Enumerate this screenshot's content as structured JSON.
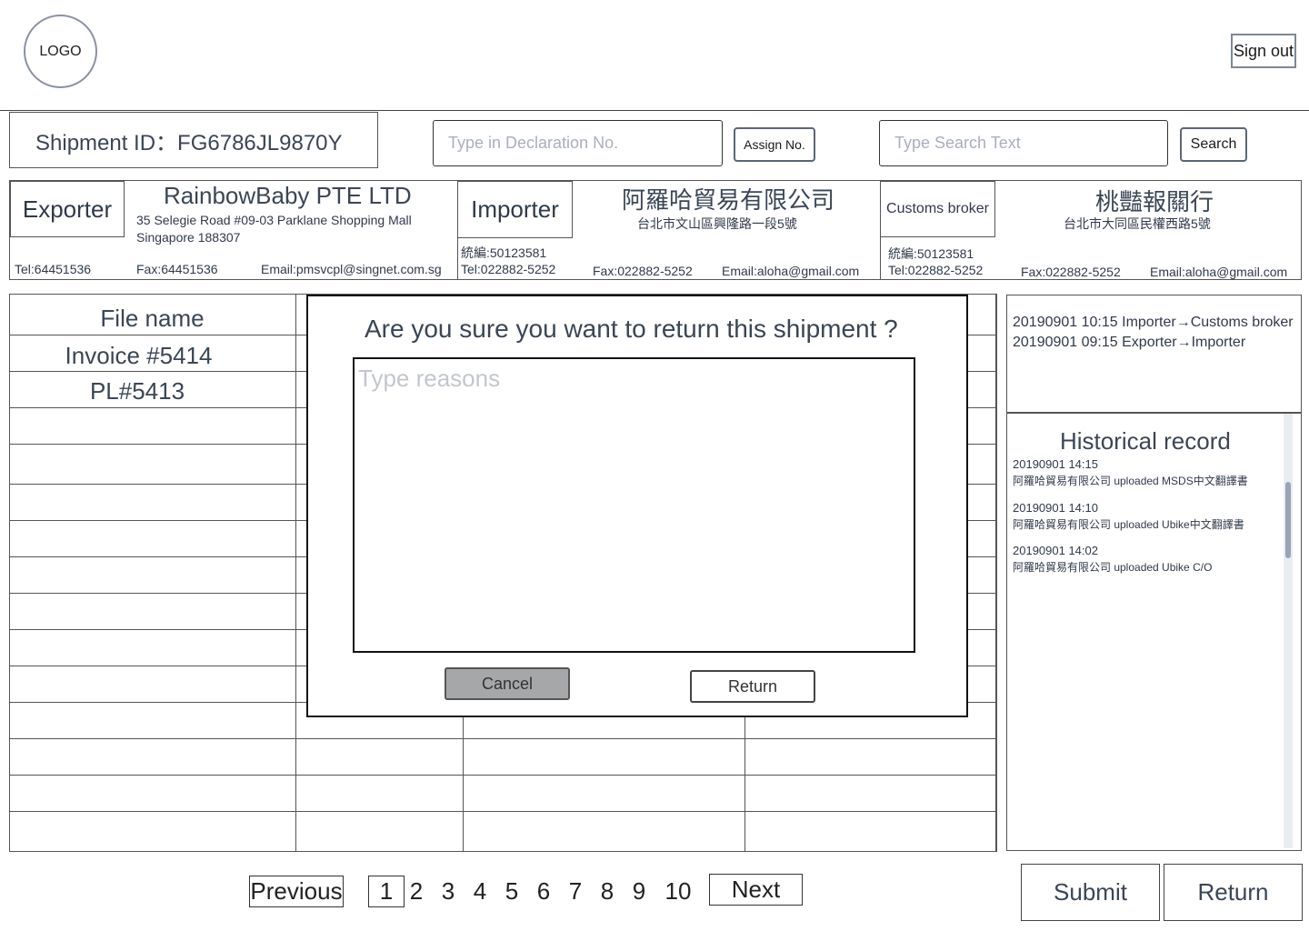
{
  "header": {
    "logo": "LOGO",
    "sign_out": "Sign out"
  },
  "shipment": {
    "id_label": "Shipment ID：FG6786JL9870Y"
  },
  "declaration": {
    "placeholder": "Type in Declaration No.",
    "assign_label": "Assign No."
  },
  "search": {
    "placeholder": "Type Search Text",
    "button": "Search"
  },
  "exporter": {
    "role": "Exporter",
    "name": "RainbowBaby PTE LTD",
    "address_line1": "35 Selegie Road  #09-03 Parklane Shopping Mall",
    "address_line2": "Singapore 188307",
    "tel": "Tel:64451536",
    "fax": "Fax:64451536",
    "email": "Email:pmsvcpl@singnet.com.sg"
  },
  "importer": {
    "role": "Importer",
    "name": "阿羅哈貿易有限公司",
    "address": "台北市文山區興隆路一段5號",
    "tax_id": "統編:50123581",
    "tel": "Tel:022882-5252",
    "fax": "Fax:022882-5252",
    "email": "Email:aloha@gmail.com"
  },
  "broker": {
    "role": "Customs broker",
    "name": "桃豔報關行",
    "address": "台北市大同區民權西路5號",
    "tax_id": "統編:50123581",
    "tel": "Tel:022882-5252",
    "fax": "Fax:022882-5252",
    "email": "Email:aloha@gmail.com"
  },
  "files": {
    "header": "File name",
    "rows": [
      "Invoice #5414",
      "PL#5413"
    ]
  },
  "modal": {
    "title": "Are you sure you want to return this shipment ?",
    "placeholder": "Type reasons",
    "cancel": "Cancel",
    "return": "Return"
  },
  "flow": [
    "20190901 10:15 Importer→Customs broker",
    "20190901 09:15 Exporter→Importer"
  ],
  "history": {
    "title": "Historical record",
    "entries": [
      {
        "time": "20190901 14:15",
        "text": "阿羅哈貿易有限公司  uploaded MSDS中文翻譯書"
      },
      {
        "time": "20190901 14:10",
        "text": "阿羅哈貿易有限公司  uploaded Ubike中文翻譯書"
      },
      {
        "time": "20190901 14:02",
        "text": " 阿羅哈貿易有限公司 uploaded Ubike C/O"
      }
    ]
  },
  "pagination": {
    "previous": "Previous",
    "pages": [
      "1",
      "2",
      "3",
      "4",
      "5",
      "6",
      "7",
      "8",
      "9",
      "10"
    ],
    "current": "1",
    "next": "Next"
  },
  "actions": {
    "submit": "Submit",
    "return": "Return"
  }
}
